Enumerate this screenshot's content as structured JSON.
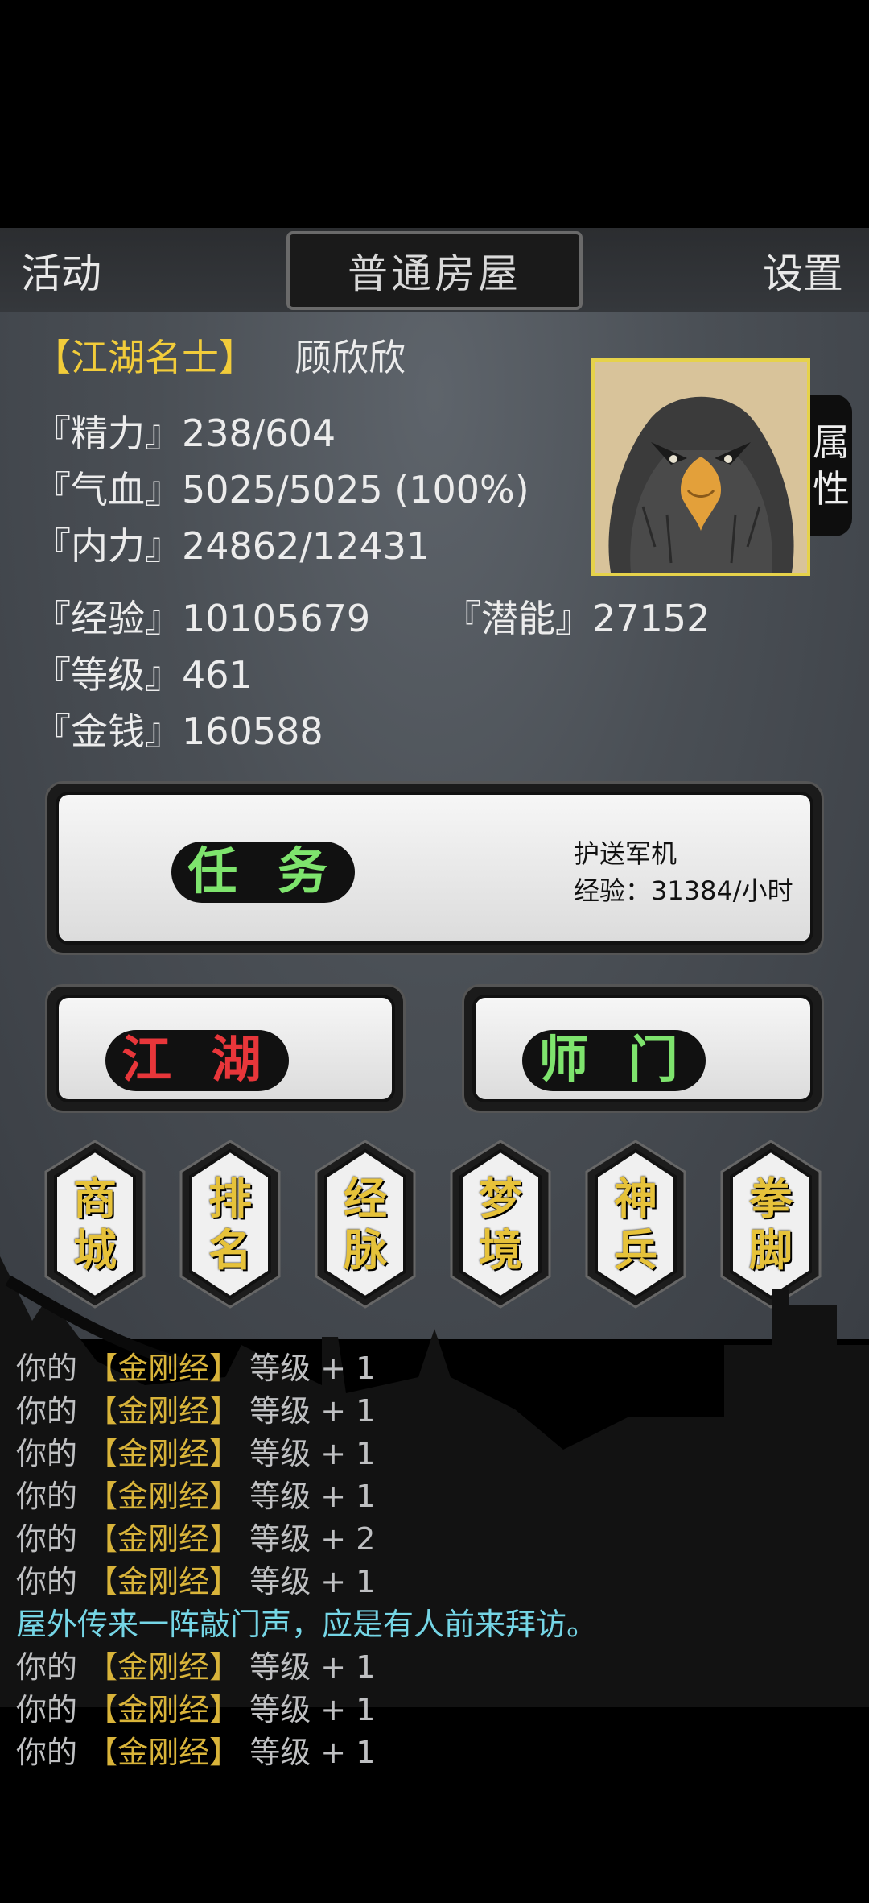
{
  "topbar": {
    "activity_label": "活动",
    "location": "普通房屋",
    "settings_label": "设置"
  },
  "player": {
    "title": "【江湖名士】",
    "name": "顾欣欣",
    "stats": {
      "stamina": "『精力』238/604",
      "health": "『气血』5025/5025 (100%)",
      "inner_power": "『内力』24862/12431",
      "experience": "『经验』10105679",
      "potential": "『潜能』27152",
      "level": "『等级』461",
      "money": "『金钱』160588"
    },
    "portrait_icon": "eagle-portrait",
    "attribute_tab": [
      "属",
      "性"
    ]
  },
  "quest": {
    "label": "任 务",
    "name": "护送军机",
    "reward": "经验：31384/小时"
  },
  "buttons": {
    "jianghu": "江 湖",
    "shimen": "师 门"
  },
  "hex_buttons": [
    [
      "商",
      "城"
    ],
    [
      "排",
      "名"
    ],
    [
      "经",
      "脉"
    ],
    [
      "梦",
      "境"
    ],
    [
      "神",
      "兵"
    ],
    [
      "拳",
      "脚"
    ]
  ],
  "log": [
    {
      "prefix": "你的",
      "item": "【金刚经】",
      "suffix": "等级 + 1"
    },
    {
      "prefix": "你的",
      "item": "【金刚经】",
      "suffix": "等级 + 1"
    },
    {
      "prefix": "你的",
      "item": "【金刚经】",
      "suffix": "等级 + 1"
    },
    {
      "prefix": "你的",
      "item": "【金刚经】",
      "suffix": "等级 + 1"
    },
    {
      "prefix": "你的",
      "item": "【金刚经】",
      "suffix": "等级 + 2"
    },
    {
      "prefix": "你的",
      "item": "【金刚经】",
      "suffix": "等级 + 1"
    },
    {
      "notice": "屋外传来一阵敲门声，应是有人前来拜访。"
    },
    {
      "prefix": "你的",
      "item": "【金刚经】",
      "suffix": "等级 + 1"
    },
    {
      "prefix": "你的",
      "item": "【金刚经】",
      "suffix": "等级 + 1"
    },
    {
      "prefix": "你的",
      "item": "【金刚经】",
      "suffix": "等级 + 1"
    }
  ],
  "colors": {
    "title": "#f2cc3a",
    "quest_green": "#7ee46d",
    "jianghu_red": "#e8363a",
    "hex_gold": "#e6c23a",
    "log_item": "#d9b43a",
    "log_notice": "#75d6e6"
  }
}
